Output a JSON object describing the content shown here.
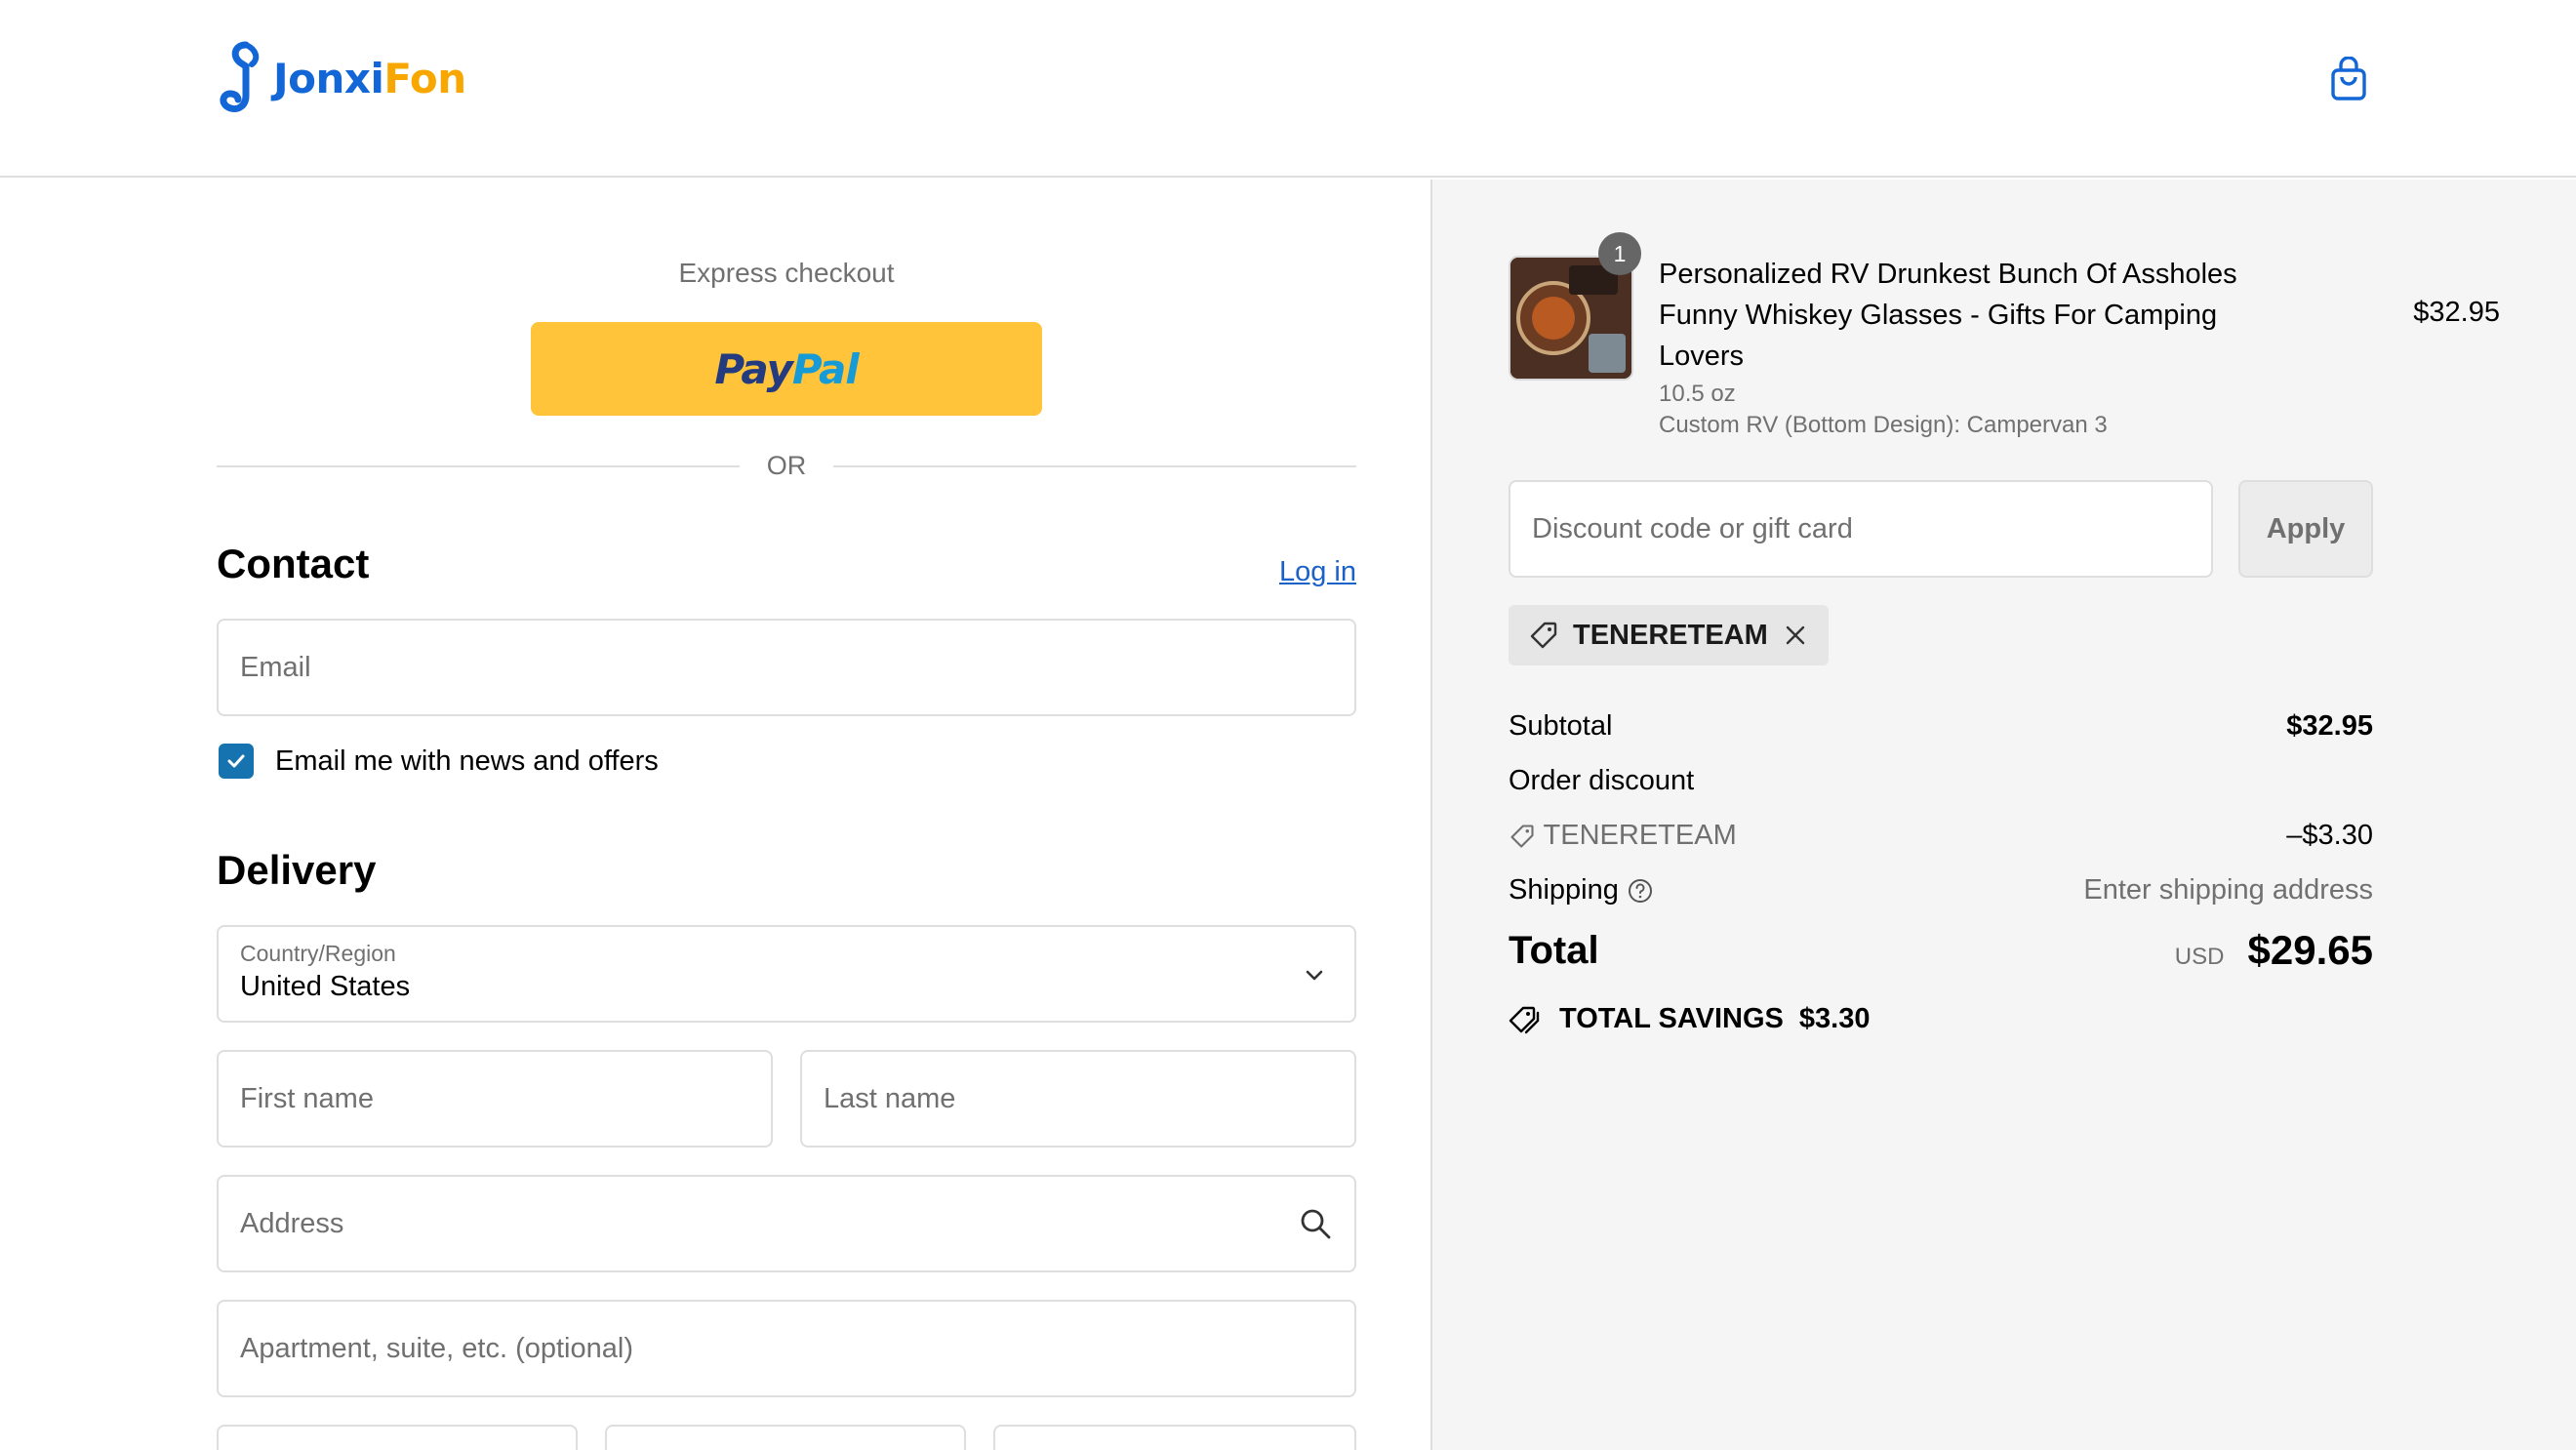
{
  "brand": {
    "part1": "Jonxi",
    "part2": "Fon",
    "primary_color": "#1266d6",
    "accent_color": "#f7a700"
  },
  "header": {
    "cart_icon": "shopping-bag-icon"
  },
  "express": {
    "label": "Express checkout",
    "paypal_pay": "Pay",
    "paypal_pal": "Pal",
    "or_label": "OR"
  },
  "contact": {
    "title": "Contact",
    "login_label": "Log in",
    "email_placeholder": "Email",
    "newsletter_label": "Email me with news and offers",
    "newsletter_checked": true
  },
  "delivery": {
    "title": "Delivery",
    "country_label": "Country/Region",
    "country_value": "United States",
    "first_name_placeholder": "First name",
    "last_name_placeholder": "Last name",
    "address_placeholder": "Address",
    "apartment_placeholder": "Apartment, suite, etc. (optional)"
  },
  "summary": {
    "product": {
      "title": "Personalized RV Drunkest Bunch Of Assholes Funny Whiskey Glasses - Gifts For Camping Lovers",
      "quantity": "1",
      "price": "$32.95",
      "variant_size": "10.5 oz",
      "variant_custom": "Custom RV (Bottom Design): Campervan 3"
    },
    "discount_placeholder": "Discount code or gift card",
    "apply_label": "Apply",
    "applied_code": "TENERETEAM",
    "subtotal_label": "Subtotal",
    "subtotal_value": "$32.95",
    "order_discount_label": "Order discount",
    "discount_code": "TENERETEAM",
    "discount_value": "–$3.30",
    "shipping_label": "Shipping",
    "shipping_value": "Enter shipping address",
    "total_label": "Total",
    "total_currency": "USD",
    "total_value": "$29.65",
    "savings_label": "TOTAL SAVINGS",
    "savings_value": "$3.30",
    "checkbox_color": "#1773b0",
    "link_color": "#1a61c8",
    "paypal_color": "#ffc439"
  }
}
